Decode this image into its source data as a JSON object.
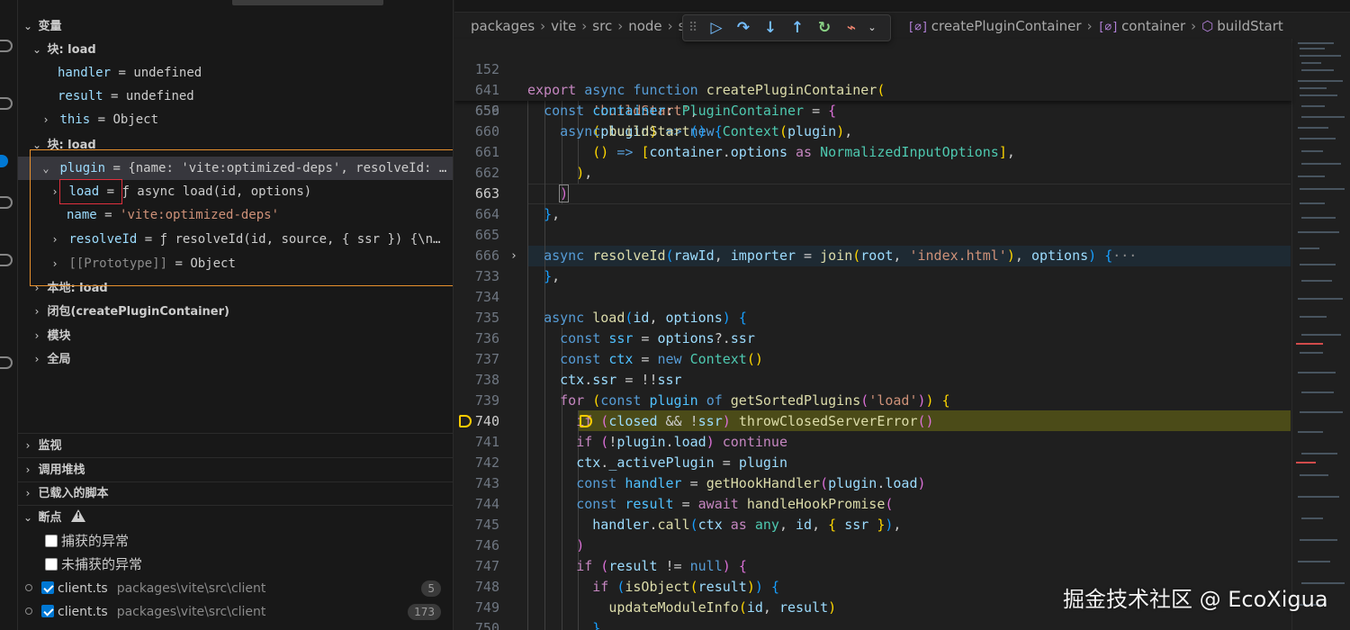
{
  "sidebar": {
    "variables": {
      "title": "变量",
      "block_load_1": {
        "label": "块: load",
        "items": [
          {
            "name": "handler",
            "eq": " = ",
            "value": "undefined"
          },
          {
            "name": "result",
            "eq": " = ",
            "value": "undefined"
          },
          {
            "name": "this",
            "eq": " = ",
            "value": "Object"
          }
        ]
      },
      "block_load_2": {
        "label": "块: load",
        "plugin": {
          "name": "plugin",
          "eq": " = ",
          "value": "{name: 'vite:optimized-deps', resolveId: …"
        },
        "children": [
          {
            "name": "load",
            "eq": " = ",
            "value": "ƒ async load(id, options)"
          },
          {
            "name": "name",
            "eq": " = ",
            "value": "'vite:optimized-deps'"
          },
          {
            "name": "resolveId",
            "eq": " = ",
            "value": "ƒ resolveId(id, source, { ssr }) {\\n…"
          },
          {
            "name": "[[Prototype]]",
            "eq": " = ",
            "value": "Object"
          }
        ]
      },
      "local_load": "本地: load",
      "closure": "闭包(createPluginContainer)",
      "module": "模块",
      "global": "全局"
    },
    "sections": {
      "watch": "监视",
      "call_stack": "调用堆栈",
      "loaded_scripts": "已载入的脚本",
      "breakpoints": "断点"
    },
    "breakpoints": {
      "caught": "捕获的异常",
      "uncaught": "未捕获的异常",
      "files": [
        {
          "file": "client.ts",
          "path": "packages\\vite\\src\\client",
          "count": "5"
        },
        {
          "file": "client.ts",
          "path": "packages\\vite\\src\\client",
          "count": "173"
        }
      ]
    }
  },
  "breadcrumbs": {
    "parts": [
      "packages",
      "vite",
      "src",
      "node",
      "se"
    ],
    "tail": [
      {
        "icon": "[∅]",
        "label": "createPluginContainer"
      },
      {
        "icon": "[∅]",
        "label": "container"
      },
      {
        "icon": "cube",
        "label": "buildStart"
      }
    ]
  },
  "debug_toolbar": {
    "icons": [
      "continue-icon",
      "step-over-icon",
      "step-into-icon",
      "step-out-icon",
      "restart-icon",
      "disconnect-icon"
    ]
  },
  "code": {
    "sticky": [
      {
        "ln": "152",
        "text": "export async function createPluginContainer("
      },
      {
        "ln": "641",
        "text": "  const container: PluginContainer = {"
      },
      {
        "ln": "656",
        "text": "    async buildStart() {"
      }
    ],
    "lines": [
      {
        "ln": "659"
      },
      {
        "ln": "660"
      },
      {
        "ln": "661"
      },
      {
        "ln": "662"
      },
      {
        "ln": "663"
      },
      {
        "ln": "664"
      },
      {
        "ln": "665"
      },
      {
        "ln": "666"
      },
      {
        "ln": "733"
      },
      {
        "ln": "734"
      },
      {
        "ln": "735"
      },
      {
        "ln": "736"
      },
      {
        "ln": "737"
      },
      {
        "ln": "738"
      },
      {
        "ln": "739"
      },
      {
        "ln": "740"
      },
      {
        "ln": "741"
      },
      {
        "ln": "742"
      },
      {
        "ln": "743"
      },
      {
        "ln": "744"
      },
      {
        "ln": "745"
      },
      {
        "ln": "746"
      },
      {
        "ln": "747"
      },
      {
        "ln": "748"
      },
      {
        "ln": "749"
      },
      {
        "ln": "750"
      }
    ]
  },
  "watermark": "掘金技术社区 @ EcoXigua",
  "colors": {
    "accent": "#0078d4",
    "highlight_orange": "#e8912d",
    "highlight_red": "#e0303e",
    "current_line": "#4b4b18"
  }
}
